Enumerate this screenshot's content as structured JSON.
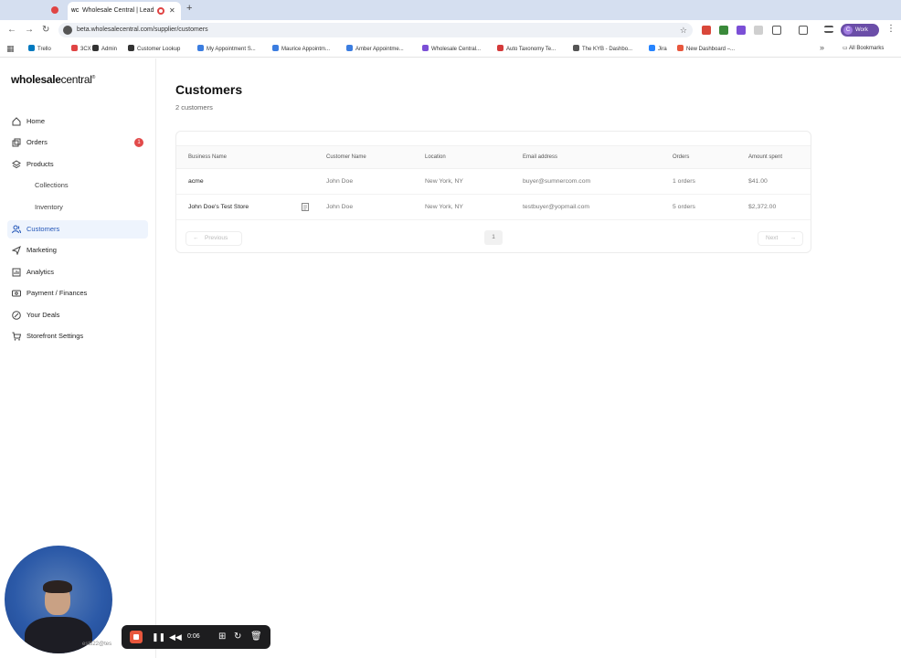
{
  "browser": {
    "active_tab_title": "Wholesale Central | Lead",
    "active_tab_favicon": "WC",
    "new_tab": "+",
    "url": "beta.wholesalecentral.com/supplier/customers",
    "profile_label": "Work",
    "profile_initial": "C",
    "bookmarks": [
      {
        "label": "Trello",
        "color": "#0079bf"
      },
      {
        "label": "3CX",
        "color": "#e04444"
      },
      {
        "label": "Admin",
        "color": "#333333"
      },
      {
        "label": "Customer Lookup",
        "color": "#333333"
      },
      {
        "label": "My Appointment S...",
        "color": "#3b7de0"
      },
      {
        "label": "Maurice Appointm...",
        "color": "#3b7de0"
      },
      {
        "label": "Amber Appointme...",
        "color": "#3b7de0"
      },
      {
        "label": "Wholesale Central...",
        "color": "#7b4fd6"
      },
      {
        "label": "Auto Taxonomy Te...",
        "color": "#d43a3a"
      },
      {
        "label": "The KYB - Dashbo...",
        "color": "#555555"
      },
      {
        "label": "Jira",
        "color": "#2684ff"
      },
      {
        "label": "New Dashboard –...",
        "color": "#e8573d"
      }
    ],
    "all_bookmarks": "All Bookmarks"
  },
  "sidebar": {
    "logo_bold": "wholesale",
    "logo_light": "central",
    "logo_mark": "®",
    "items": [
      {
        "label": "Home",
        "icon": "home-icon"
      },
      {
        "label": "Orders",
        "icon": "orders-icon",
        "badge": "1"
      },
      {
        "label": "Products",
        "icon": "layers-icon"
      },
      {
        "label": "Collections"
      },
      {
        "label": "Inventory"
      },
      {
        "label": "Customers",
        "icon": "users-icon",
        "active": true
      },
      {
        "label": "Marketing",
        "icon": "marketing-icon"
      },
      {
        "label": "Analytics",
        "icon": "chart-icon"
      },
      {
        "label": "Payment / Finances",
        "icon": "payment-icon"
      },
      {
        "label": "Your Deals",
        "icon": "percent-icon"
      },
      {
        "label": "Storefront Settings",
        "icon": "cart-icon"
      }
    ]
  },
  "main": {
    "title": "Customers",
    "subtitle": "2 customers",
    "table": {
      "columns": [
        "Business Name",
        "Customer Name",
        "Location",
        "Email address",
        "Orders",
        "Amount spent"
      ],
      "rows": [
        [
          "acme",
          "John Doe",
          "New York, NY",
          "buyer@sumnercom.com",
          "1 orders",
          "$41.00"
        ],
        [
          "John Doe's Test Store",
          "John Doe",
          "New York, NY",
          "testbuyer@yopmail.com",
          "5 orders",
          "$2,372.00"
        ]
      ]
    },
    "pagination": {
      "previous": "Previous",
      "page": "1",
      "next": "Next"
    }
  },
  "recorder": {
    "time": "0:06",
    "footer_text": "WC",
    "footer_email": "est822@tes"
  },
  "colors": {
    "accent": "#2457b8",
    "badge": "#e24a4a",
    "record": "#e8573d"
  }
}
